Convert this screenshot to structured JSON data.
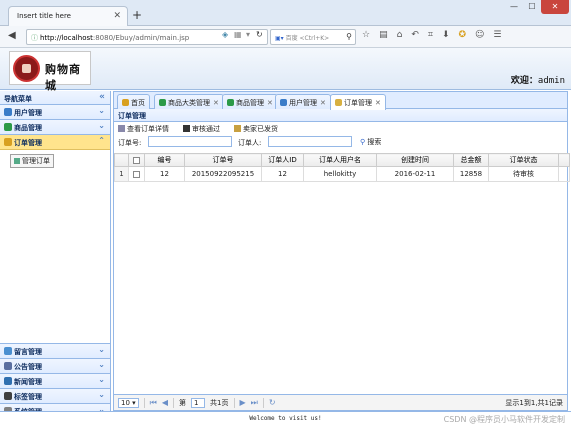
{
  "browser": {
    "tab_title": "Insert title here",
    "url_host": "http://localhost",
    "url_path": ":8080/Ebuy/admin/main.jsp",
    "search_placeholder": "百度 <Ctrl+K>"
  },
  "header": {
    "logo_text": "购物商城",
    "welcome_label": "欢迎：",
    "username": "admin"
  },
  "sidebar": {
    "title": "导航菜单",
    "sections": [
      {
        "label": "用户管理",
        "color": "#3a7cc8"
      },
      {
        "label": "商品管理",
        "color": "#2c9a48"
      },
      {
        "label": "订单管理",
        "color": "#d8a020"
      }
    ],
    "sub_item": "管理订单",
    "bottom_sections": [
      {
        "label": "留言管理",
        "color": "#4a8fd0"
      },
      {
        "label": "公告管理",
        "color": "#5a6fa0"
      },
      {
        "label": "新闻管理",
        "color": "#3070b0"
      },
      {
        "label": "标签管理",
        "color": "#404040"
      },
      {
        "label": "系统管理",
        "color": "#808080"
      }
    ]
  },
  "tabs": [
    {
      "label": "首页",
      "color": "#d8a020"
    },
    {
      "label": "商品大类管理",
      "color": "#2c9a48"
    },
    {
      "label": "商品管理",
      "color": "#2c9a48"
    },
    {
      "label": "用户管理",
      "color": "#3a7cc8"
    },
    {
      "label": "订单管理",
      "color": "#d8b040"
    }
  ],
  "panel": {
    "title": "订单管理",
    "toolbar": [
      "查看订单详情",
      "审核通过",
      "卖家已发货"
    ],
    "filter_order_no_label": "订单号:",
    "filter_orderer_label": "订单人:",
    "search_label": "搜索"
  },
  "table": {
    "columns": [
      "编号",
      "订单号",
      "订单人ID",
      "订单人用户名",
      "创建时间",
      "总金额",
      "订单状态"
    ],
    "rows": [
      {
        "rownum": "1",
        "id": "12",
        "order_no": "20150922095215",
        "user_id": "12",
        "username": "hellokitty",
        "created": "2016-02-11",
        "total": "12858",
        "status": "待审核"
      }
    ]
  },
  "pager": {
    "page_size": "10",
    "page_label_pre": "第",
    "page_value": "1",
    "page_label_post": "共1页",
    "info": "显示1到1,共1记录"
  },
  "footer": "Welcome to visit us!",
  "watermark": "CSDN @程序员小马软件开发定制"
}
